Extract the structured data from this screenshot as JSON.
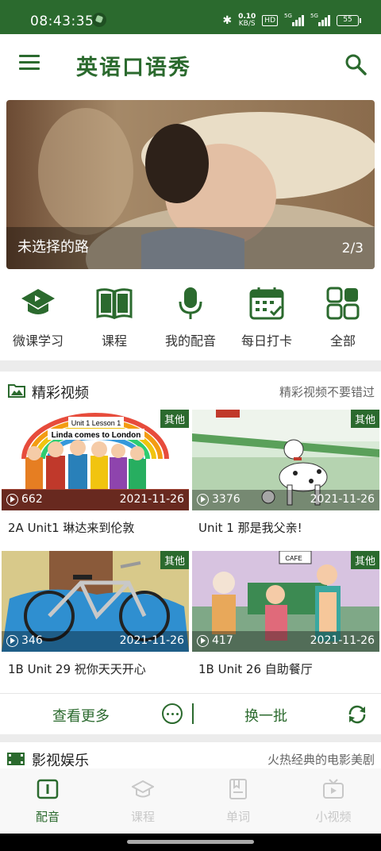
{
  "status": {
    "time": "08:43:35",
    "net_speed_value": "0.10",
    "net_speed_unit": "KB/S",
    "hd": "HD",
    "sig1": "5G",
    "sig2": "5G",
    "battery": "55"
  },
  "appbar": {
    "title": "英语口语秀"
  },
  "banner": {
    "title": "未选择的路",
    "index": "2/3"
  },
  "quick": [
    {
      "label": "微课学习",
      "icon": "graduation-cap-icon"
    },
    {
      "label": "课程",
      "icon": "book-icon"
    },
    {
      "label": "我的配音",
      "icon": "microphone-icon"
    },
    {
      "label": "每日打卡",
      "icon": "calendar-check-icon"
    },
    {
      "label": "全部",
      "icon": "grid-icon"
    }
  ],
  "section": {
    "title": "精彩视频",
    "subtitle": "精彩视频不要错过",
    "cards": [
      {
        "tag": "其他",
        "plays": "662",
        "date": "2021-11-26",
        "title": "2A Unit1 琳达来到伦敦",
        "thumb_text1": "Unit 1 Lesson 1",
        "thumb_text2": "Linda comes to London"
      },
      {
        "tag": "其他",
        "plays": "3376",
        "date": "2021-11-26",
        "title": "Unit 1 那是我父亲!"
      },
      {
        "tag": "其他",
        "plays": "346",
        "date": "2021-11-26",
        "title": "1B Unit 29 祝你天天开心"
      },
      {
        "tag": "其他",
        "plays": "417",
        "date": "2021-11-26",
        "title": "1B Unit 26 自助餐厅",
        "thumb_text1": "CAFE"
      }
    ],
    "more_label": "查看更多",
    "batch_label": "换一批"
  },
  "section2": {
    "title": "影视娱乐",
    "subtitle": "火热经典的电影美剧"
  },
  "bottomnav": [
    {
      "label": "配音",
      "icon": "dub-book-icon",
      "active": true
    },
    {
      "label": "课程",
      "icon": "course-cap-icon",
      "active": false
    },
    {
      "label": "单词",
      "icon": "word-book-icon",
      "active": false
    },
    {
      "label": "小视频",
      "icon": "tv-icon",
      "active": false
    }
  ],
  "colors": {
    "primary": "#2b6a2e",
    "inactive": "#c8c8c8"
  }
}
